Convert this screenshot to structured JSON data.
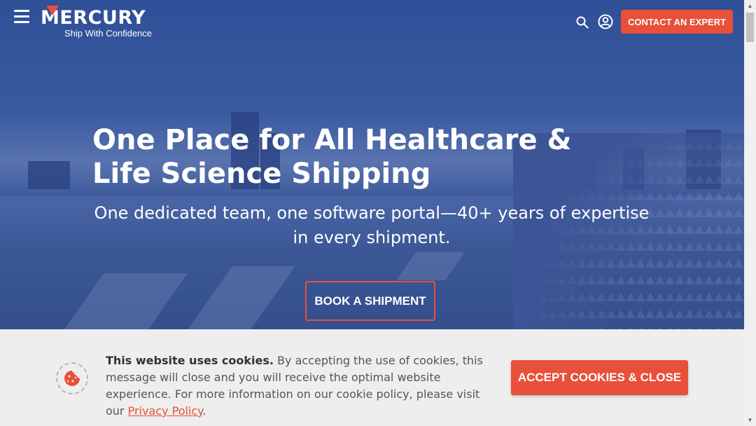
{
  "header": {
    "logo_text": "MERCURY",
    "logo_tagline": "Ship With Confidence",
    "contact_label": "CONTACT AN EXPERT",
    "icons": [
      "menu-icon",
      "search-icon",
      "user-icon"
    ]
  },
  "hero": {
    "title": "One Place for All Healthcare & Life Science Shipping",
    "subtitle": "One dedicated team, one software portal—40+ years of expertise in every shipment.",
    "cta_label": "BOOK A SHIPMENT"
  },
  "cookie_banner": {
    "heading": "This website uses cookies.",
    "body": " By accepting the use of cookies, this message will close and you will receive the optimal website experience. For more information on our cookie policy, please visit our ",
    "link_label": "Privacy Policy",
    "trailing": ".",
    "accept_label": "ACCEPT COOKIES & CLOSE",
    "icon": "cookie-icon"
  },
  "colors": {
    "accent": "#e8503a",
    "hero_bg": "#2f4f98",
    "banner_bg": "#eeeeee"
  }
}
